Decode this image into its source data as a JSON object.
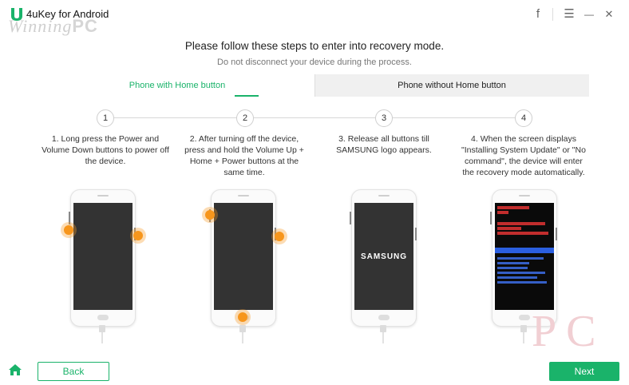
{
  "app": {
    "title": "4uKey for Android"
  },
  "watermark": {
    "text_italic": "Winning",
    "text_bold": "PC"
  },
  "window_controls": {
    "facebook": "f",
    "menu": "☰",
    "minimize": "—",
    "close": "✕"
  },
  "header": {
    "title": "Please follow these steps to enter into recovery mode.",
    "subtitle": "Do not disconnect your device during the process."
  },
  "tabs": [
    {
      "label": "Phone with Home button",
      "active": true
    },
    {
      "label": "Phone without Home button",
      "active": false
    }
  ],
  "steps": [
    {
      "number": "1",
      "text": "1. Long press the Power and Volume Down buttons to power off the device."
    },
    {
      "number": "2",
      "text": "2. After turning off the device, press and hold the Volume Up + Home + Power buttons at the same time."
    },
    {
      "number": "3",
      "text": "3. Release all buttons till SAMSUNG logo appears."
    },
    {
      "number": "4",
      "text": "4. When the screen displays \"Installing System Update\" or \"No command\", the device will enter the recovery mode automatically."
    }
  ],
  "phone_screen": {
    "samsung_logo": "SAMSUNG",
    "recovery_menu_selected": "reboot system now"
  },
  "corner_watermark": "PC",
  "footer": {
    "back_label": "Back",
    "next_label": "Next"
  },
  "colors": {
    "accent": "#1ab36a",
    "press_highlight": "#f7961c"
  }
}
